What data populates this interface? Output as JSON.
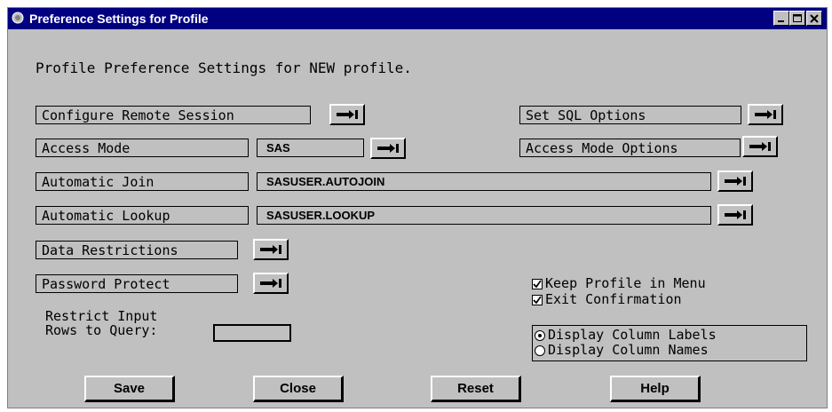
{
  "window": {
    "title": "Preference Settings for Profile",
    "controls": {
      "minimize": "minimize-icon",
      "maximize": "maximize-icon",
      "close": "close-icon"
    }
  },
  "heading": "Profile Preference Settings for NEW profile.",
  "rows": {
    "configure_remote": {
      "label": "Configure Remote Session"
    },
    "sql_options": {
      "label": "Set SQL Options"
    },
    "access_mode": {
      "label": "Access Mode",
      "value": "SAS"
    },
    "access_mode_options": {
      "label": "Access Mode Options"
    },
    "automatic_join": {
      "label": "Automatic Join",
      "value": "SASUSER.AUTOJOIN"
    },
    "automatic_lookup": {
      "label": "Automatic Lookup",
      "value": "SASUSER.LOOKUP"
    },
    "data_restrictions": {
      "label": "Data Restrictions"
    },
    "password_protect": {
      "label": "Password Protect"
    }
  },
  "restrict": {
    "line1": "Restrict Input",
    "line2": "Rows to Query:",
    "value": ""
  },
  "checkboxes": [
    {
      "label": "Keep Profile in Menu",
      "checked": true
    },
    {
      "label": "Exit Confirmation",
      "checked": true
    }
  ],
  "radios": [
    {
      "label": "Display Column Labels",
      "selected": true
    },
    {
      "label": "Display Column Names",
      "selected": false
    }
  ],
  "buttons": {
    "save": "Save",
    "close": "Close",
    "reset": "Reset",
    "help": "Help"
  },
  "colors": {
    "titlebar": "#000080",
    "background": "#c0c0c0"
  }
}
